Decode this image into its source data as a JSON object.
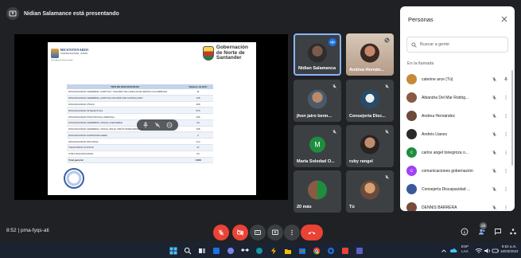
{
  "presenter": {
    "text": "Nidian Salamance está presentando"
  },
  "slide": {
    "brand_left_title": "BICENTENARIO",
    "brand_left_sub": "COMUNICACIONES · NORTE",
    "brand_left_footer": "Una gobernación para todos",
    "gov_line1": "Gobernación",
    "gov_line2": "de Norte de",
    "gov_line3": "Santander",
    "table": {
      "headers": [
        "TIPO DE DISCAPACIDAD",
        "Número de ECU"
      ],
      "rows": [
        [
          "DISCAPACIDAD CEREBRAL AUDITIVA / USUARIO DE LENGUA DE SEÑAS COLOMBIANA",
          "41"
        ],
        [
          "DISCAPACIDAD CEREBRAL AUDITIVA USUARIO DE CASTELLANO",
          "128"
        ],
        [
          "DISCAPACIDAD FÍSICA",
          "268"
        ],
        [
          "DISCAPACIDAD INTELECTUAL",
          "576"
        ],
        [
          "DISCAPACIDAD PSICOSOCIAL (MENTAL)",
          "236"
        ],
        [
          "DISCAPACIDAD CEREBRAL VISUAL (CEGUERA)",
          "54"
        ],
        [
          "DISCAPACIDAD CEREBRAL VISUAL (BAJA VISIÓN IRREVERSIBLE)",
          "105"
        ],
        [
          "DISCAPACIDAD SORDOCEGUERA",
          "3"
        ],
        [
          "DISCAPACIDAD MÚLTIPLE",
          "214"
        ],
        [
          "TRASTORNO AUTISTA",
          "47"
        ],
        [
          "OTRA DISCAPACIDAD",
          "64"
        ],
        [
          "Total general",
          "1.608"
        ]
      ]
    }
  },
  "tiles": [
    {
      "name": "Nidian Salamanca"
    },
    {
      "name": "Andrea Hernán..."
    },
    {
      "name": "jhon jairo benn..."
    },
    {
      "name": "Consejería Disc..."
    },
    {
      "name": "María Soledad O...",
      "letter": "M"
    },
    {
      "name": "ruby rangel"
    },
    {
      "name": "20 más"
    },
    {
      "name": "Tú"
    }
  ],
  "panel": {
    "title": "Personas",
    "search_placeholder": "Buscar a gente",
    "section": "En la llamada",
    "people": [
      {
        "name": "caterine arce (Tú)",
        "color": "#c58a3a",
        "letter": ""
      },
      {
        "name": "Abiandra Del Mar Rodrig...",
        "color": "#8a5a44",
        "letter": ""
      },
      {
        "name": "Andrea Hernández",
        "color": "#6b4a3a",
        "letter": ""
      },
      {
        "name": "Andrés Llanos",
        "color": "#2a2a2a",
        "letter": ""
      },
      {
        "name": "carlos angel tonegroza o...",
        "color": "#1e8e3e",
        "letter": "c"
      },
      {
        "name": "comunicaciones gobernación",
        "color": "#a142f4",
        "letter": "c"
      },
      {
        "name": "Consejería Discapacidad ...",
        "color": "#3b5998",
        "letter": ""
      },
      {
        "name": "DENNIS BARRERA",
        "color": "#7a4a3a",
        "letter": ""
      }
    ]
  },
  "bottom": {
    "meta": "8:52  |  pma-fyqs-ati",
    "participants_count": "28"
  },
  "tray": {
    "lang": "ESP",
    "layout": "LAA",
    "time": "8:52 a.m.",
    "date": "16/03/2022"
  }
}
